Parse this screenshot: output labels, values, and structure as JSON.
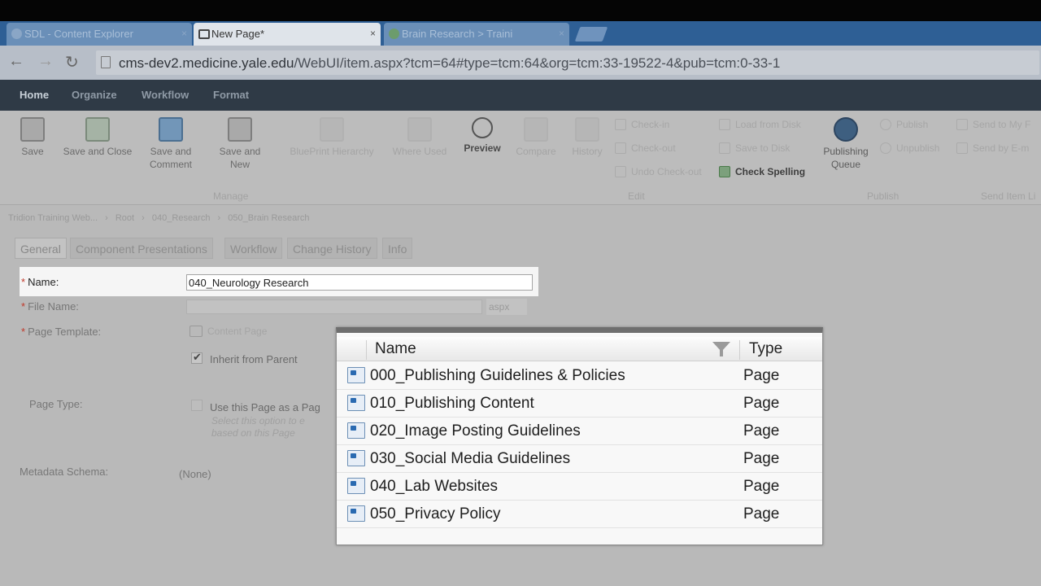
{
  "browser": {
    "tabs": [
      {
        "label": "SDL - Content Explorer",
        "active": false
      },
      {
        "label": "New Page*",
        "active": true
      },
      {
        "label": "Brain Research > Traini",
        "active": false
      }
    ],
    "close_glyph": "×",
    "url_host": "cms-dev2.medicine.yale.edu",
    "url_path": "/WebUI/item.aspx?tcm=64#type=tcm:64&org=tcm:33-19522-4&pub=tcm:0-33-1"
  },
  "menu": {
    "items": [
      "Home",
      "Organize",
      "Workflow",
      "Format"
    ]
  },
  "ribbon": {
    "buttons": [
      {
        "label": "Save",
        "label2": ""
      },
      {
        "label": "Save and Close",
        "label2": ""
      },
      {
        "label": "Save and",
        "label2": "Comment"
      },
      {
        "label": "Save and",
        "label2": "New"
      },
      {
        "label": "BluePrint Hierarchy",
        "label2": ""
      },
      {
        "label": "Where Used",
        "label2": ""
      },
      {
        "label": "Preview",
        "label2": ""
      },
      {
        "label": "Compare",
        "label2": ""
      },
      {
        "label": "History",
        "label2": ""
      },
      {
        "label": "Publishing",
        "label2": "Queue"
      }
    ],
    "small": [
      "Check-in",
      "Check-out",
      "Undo Check-out",
      "Load from Disk",
      "Save to Disk",
      "Check Spelling",
      "Publish",
      "Unpublish",
      "Send to My F",
      "Send by E-m"
    ],
    "groups": [
      "Manage",
      "Edit",
      "Publish",
      "Send Item Li"
    ]
  },
  "breadcrumb": [
    "Tridion Training Web...",
    "›",
    "Root",
    "›",
    "040_Research",
    "›",
    "050_Brain Research"
  ],
  "form_tabs": [
    "General",
    "Component Presentations",
    "Workflow",
    "Change History",
    "Info"
  ],
  "form": {
    "required_mark": "*",
    "name_label": "Name:",
    "name_value": "040_Neurology Research",
    "filename_label": "File Name:",
    "aspx": "aspx",
    "template_label": "Page Template:",
    "template_value": "Content Page",
    "inherit_label": "Inherit from Parent",
    "pagetype_label": "Page Type:",
    "pagetype_option": "Use this Page as a Pag",
    "pagetype_hint1": "Select this option to e",
    "pagetype_hint2": "based on this Page",
    "metadata_label": "Metadata Schema:",
    "metadata_value": "(None)"
  },
  "popup": {
    "headers": {
      "name": "Name",
      "type": "Type"
    },
    "rows": [
      {
        "name": "000_Publishing Guidelines & Policies",
        "type": "Page"
      },
      {
        "name": "010_Publishing Content",
        "type": "Page"
      },
      {
        "name": "020_Image Posting Guidelines",
        "type": "Page"
      },
      {
        "name": "030_Social Media Guidelines",
        "type": "Page"
      },
      {
        "name": "040_Lab Websites",
        "type": "Page"
      },
      {
        "name": "050_Privacy Policy",
        "type": "Page"
      }
    ]
  }
}
